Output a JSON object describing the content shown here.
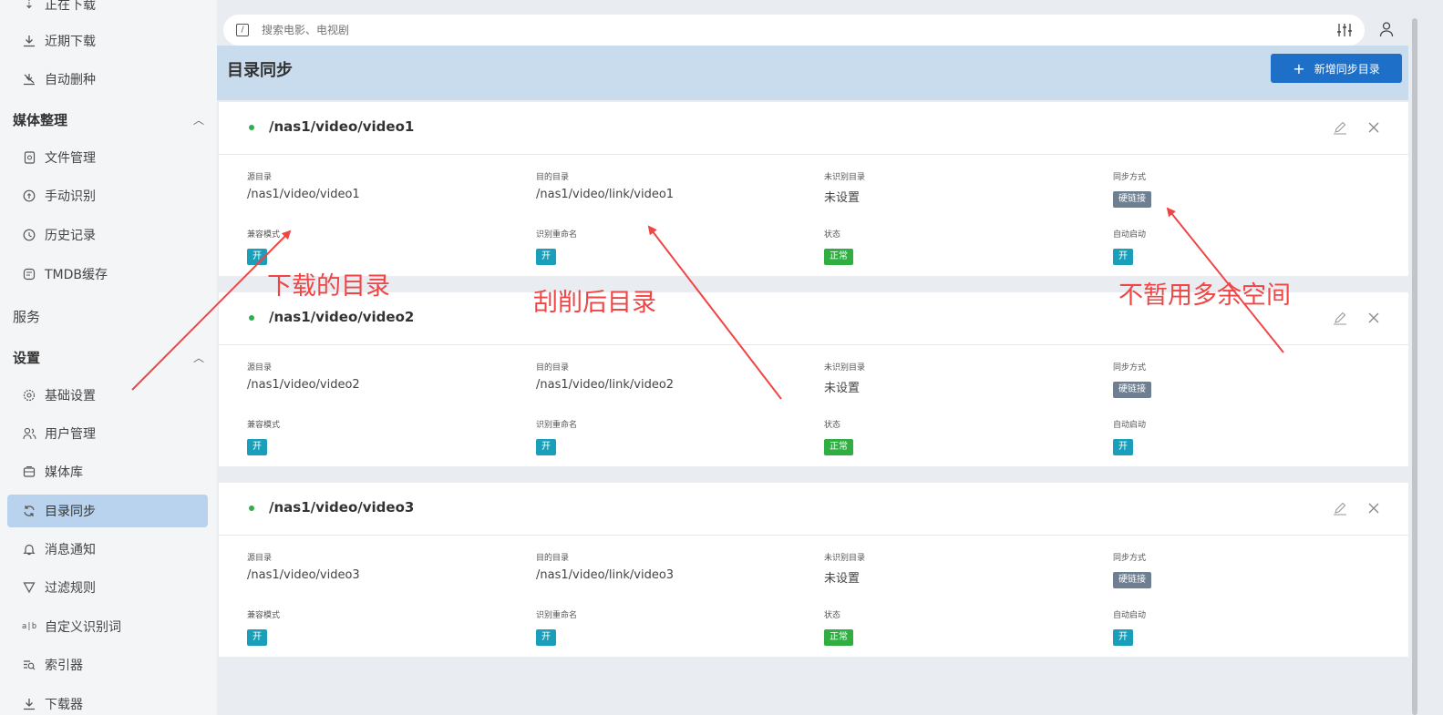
{
  "sidebar": {
    "cut_item": {
      "label": "正在下载"
    },
    "items_top": [
      {
        "label": "近期下载",
        "icon": "download-icon"
      },
      {
        "label": "自动删种",
        "icon": "auto-delete-icon"
      }
    ],
    "group_media": {
      "label": "媒体整理",
      "chevron": "^"
    },
    "items_media": [
      {
        "label": "文件管理",
        "icon": "file-icon"
      },
      {
        "label": "手动识别",
        "icon": "identify-icon"
      },
      {
        "label": "历史记录",
        "icon": "history-icon"
      },
      {
        "label": "TMDB缓存",
        "icon": "cache-icon"
      }
    ],
    "services": {
      "label": "服务"
    },
    "group_settings": {
      "label": "设置",
      "chevron": "^"
    },
    "items_settings": [
      {
        "label": "基础设置",
        "icon": "gear-icon"
      },
      {
        "label": "用户管理",
        "icon": "users-icon"
      },
      {
        "label": "媒体库",
        "icon": "library-icon"
      },
      {
        "label": "目录同步",
        "icon": "sync-icon",
        "active": true
      },
      {
        "label": "消息通知",
        "icon": "bell-icon"
      },
      {
        "label": "过滤规则",
        "icon": "filter-icon"
      },
      {
        "label": "自定义识别词",
        "icon": "custom-words-icon"
      },
      {
        "label": "索引器",
        "icon": "indexer-icon"
      },
      {
        "label": "下载器",
        "icon": "downloader-icon"
      }
    ]
  },
  "search": {
    "placeholder": "搜索电影、电视剧",
    "shortcut": "/"
  },
  "page": {
    "title": "目录同步",
    "add_button": "新增同步目录"
  },
  "field_labels": {
    "source": "源目录",
    "target": "目的目录",
    "unknown": "未识别目录",
    "sync_mode": "同步方式",
    "compat": "兼容模式",
    "rename": "识别重命名",
    "status": "状态",
    "autostart": "自动启动"
  },
  "cards": [
    {
      "path": "/nas1/video/video1",
      "source": "/nas1/video/video1",
      "target": "/nas1/video/link/video1",
      "unknown": "未设置",
      "sync_mode": "硬链接",
      "compat": "开",
      "rename": "开",
      "status": "正常",
      "autostart": "开"
    },
    {
      "path": "/nas1/video/video2",
      "source": "/nas1/video/video2",
      "target": "/nas1/video/link/video2",
      "unknown": "未设置",
      "sync_mode": "硬链接",
      "compat": "开",
      "rename": "开",
      "status": "正常",
      "autostart": "开"
    },
    {
      "path": "/nas1/video/video3",
      "source": "/nas1/video/video3",
      "target": "/nas1/video/link/video3",
      "unknown": "未设置",
      "sync_mode": "硬链接",
      "compat": "开",
      "rename": "开",
      "status": "正常",
      "autostart": "开"
    }
  ],
  "annotations": {
    "download_dir": "下载的目录",
    "scraped_dir": "刮削后目录",
    "no_extra_space": "不暂用多余空间",
    "color": "#f04545"
  }
}
